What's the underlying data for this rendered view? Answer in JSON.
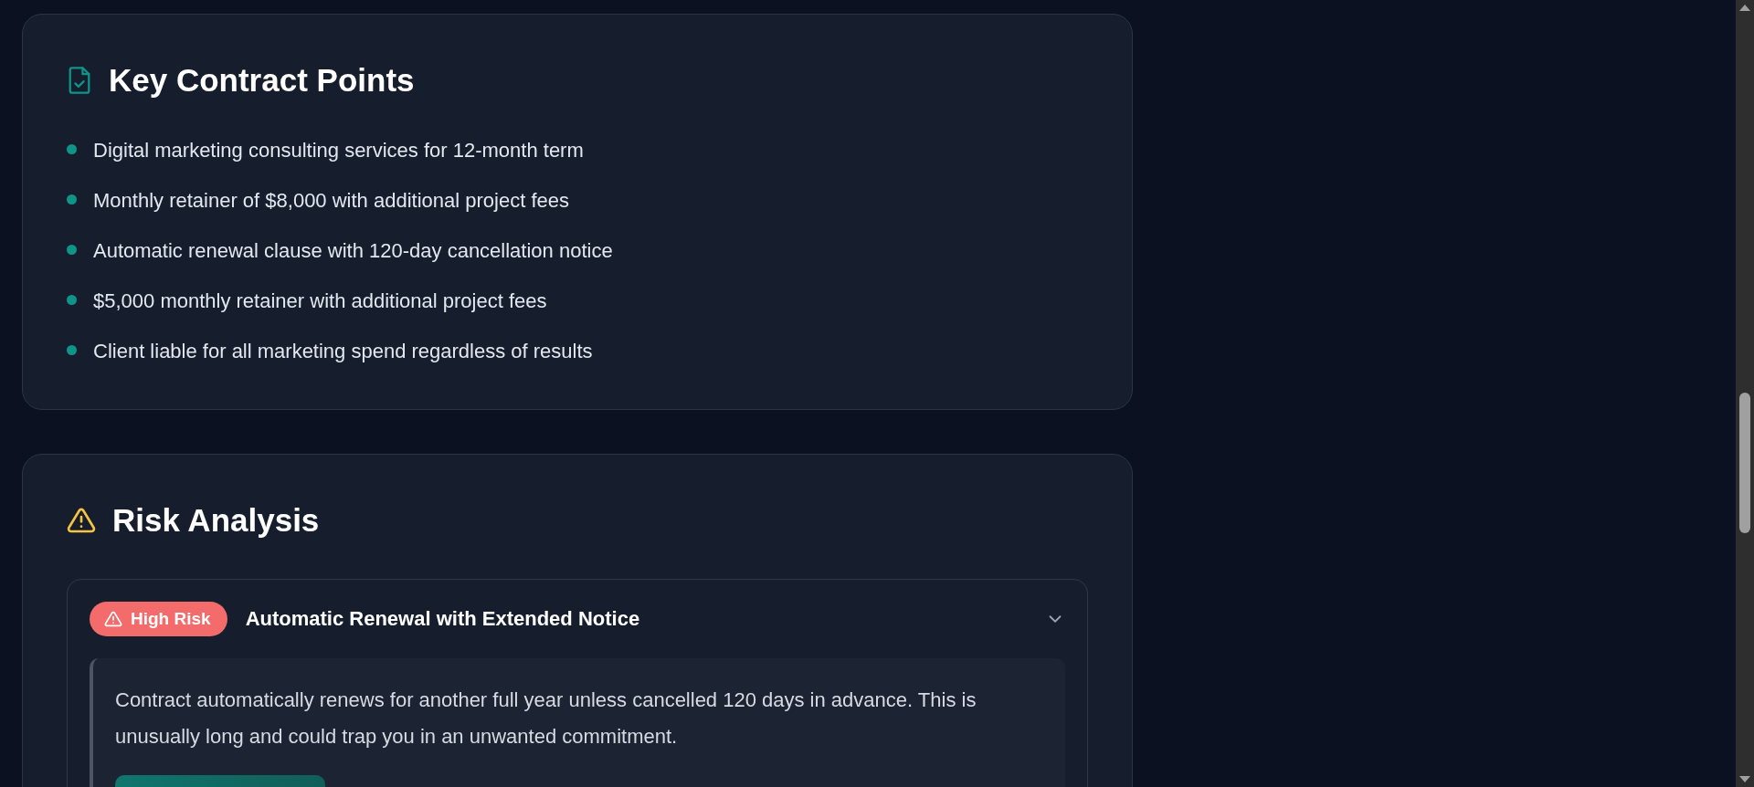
{
  "key_points": {
    "title": "Key Contract Points",
    "items": [
      "Digital marketing consulting services for 12-month term",
      "Monthly retainer of $8,000 with additional project fees",
      "Automatic renewal clause with 120-day cancellation notice",
      "$5,000 monthly retainer with additional project fees",
      "Client liable for all marketing spend regardless of results"
    ]
  },
  "risk_analysis": {
    "title": "Risk Analysis",
    "risks": [
      {
        "kind": "high",
        "badge": "High Risk",
        "title": "Automatic Renewal with Extended Notice",
        "expanded": true,
        "description": "Contract automatically renews for another full year unless cancelled 120 days in advance. This is unusually long and could trap you in an unwanted commitment."
      }
    ]
  }
}
